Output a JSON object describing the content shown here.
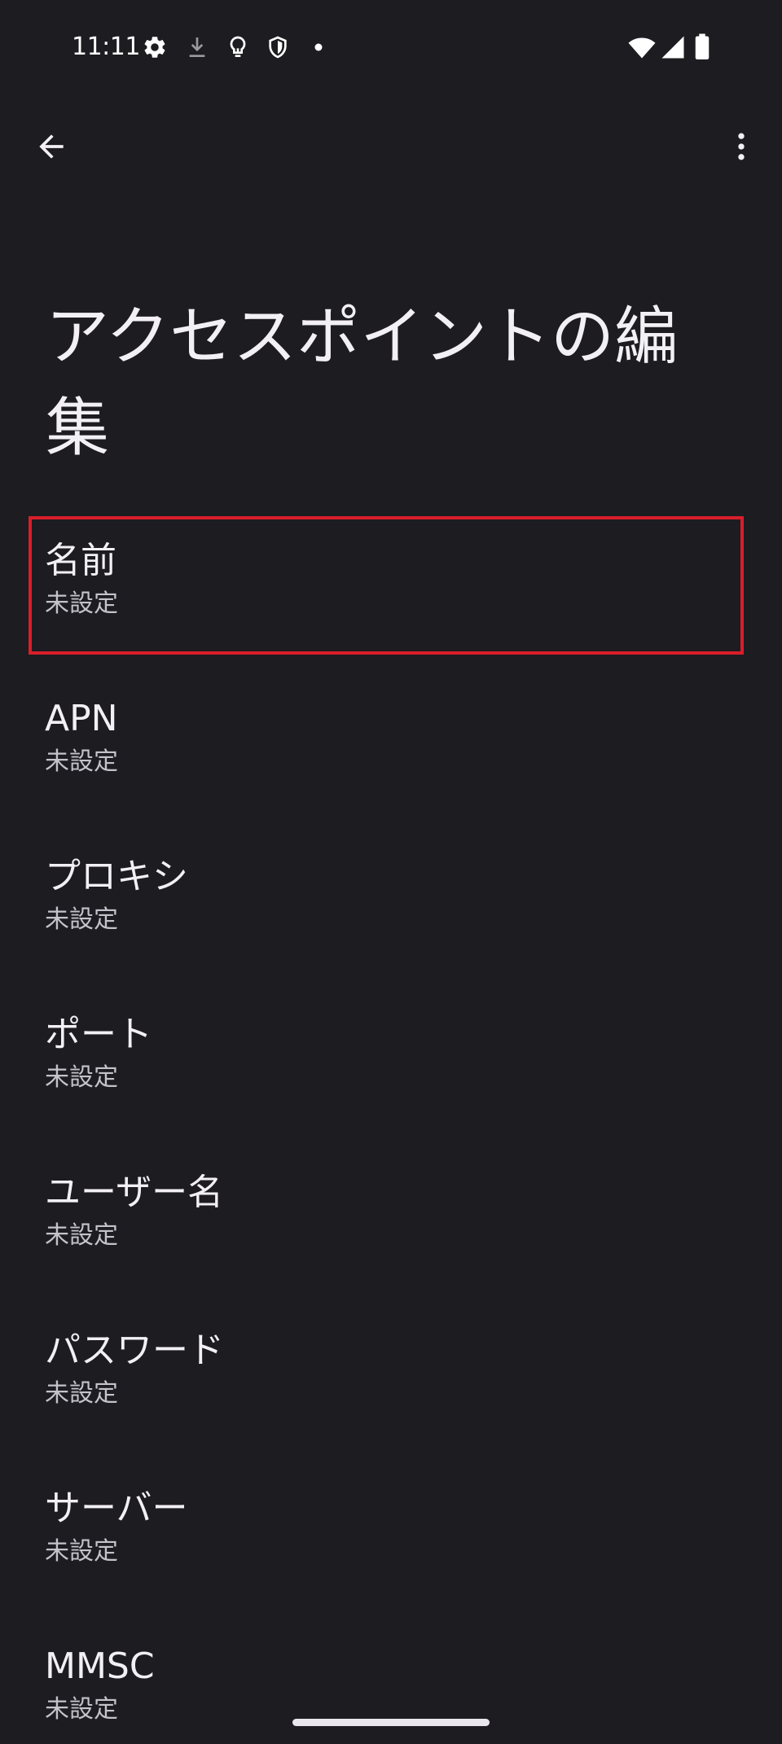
{
  "status_bar": {
    "time": "11:11",
    "left_icons": [
      "settings-gear-icon",
      "download-icon",
      "lightbulb-icon",
      "shield-icon",
      "dot-icon"
    ],
    "right_icons": [
      "wifi-icon",
      "cell-signal-icon",
      "battery-icon"
    ]
  },
  "app_bar": {
    "back_icon": "arrow-back-icon",
    "more_icon": "more-vert-icon"
  },
  "page": {
    "title": "アクセスポイントの編集"
  },
  "preferences": [
    {
      "title": "名前",
      "summary": "未設定",
      "highlighted": true
    },
    {
      "title": "APN",
      "summary": "未設定"
    },
    {
      "title": "プロキシ",
      "summary": "未設定"
    },
    {
      "title": "ポート",
      "summary": "未設定"
    },
    {
      "title": "ユーザー名",
      "summary": "未設定"
    },
    {
      "title": "パスワード",
      "summary": "未設定"
    },
    {
      "title": "サーバー",
      "summary": "未設定"
    },
    {
      "title": "MMSC",
      "summary": "未設定"
    }
  ],
  "colors": {
    "background": "#1d1c21",
    "text_primary": "#f2f0f5",
    "text_secondary": "#c5c3ca",
    "highlight_border": "#d91e2a"
  }
}
